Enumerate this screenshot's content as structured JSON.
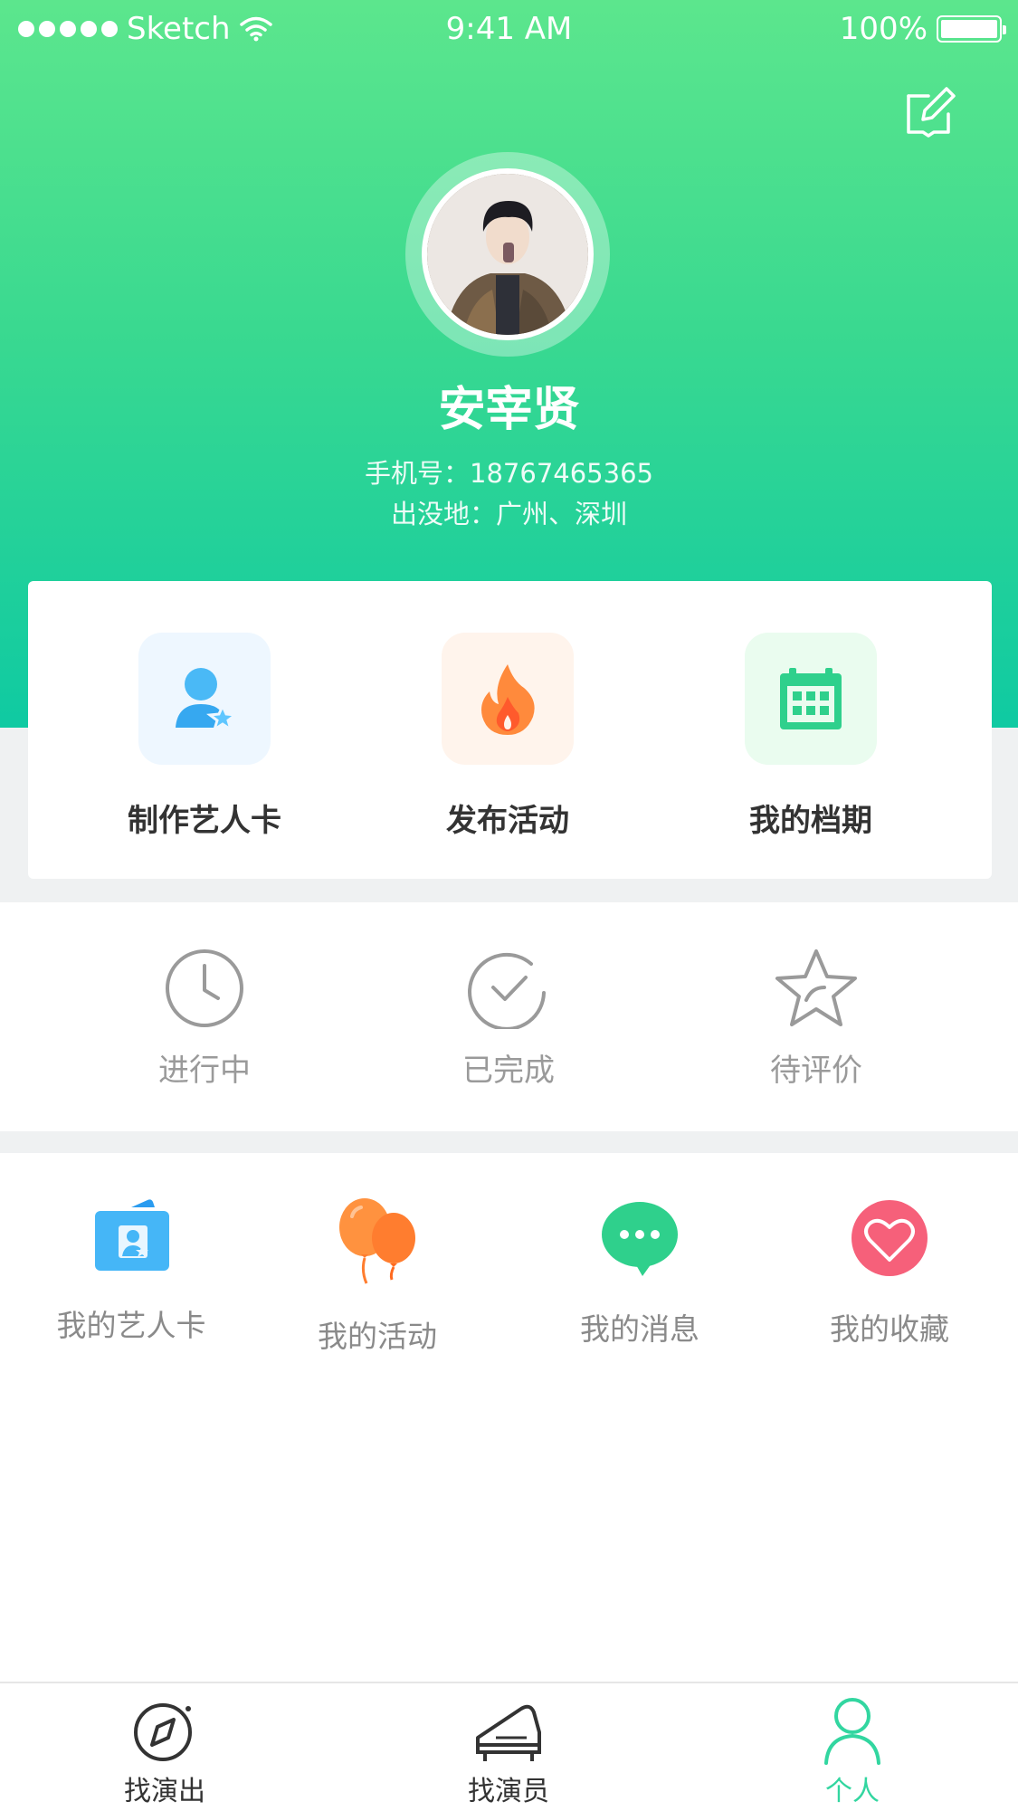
{
  "status_bar": {
    "carrier": "Sketch",
    "time": "9:41 AM",
    "battery": "100%"
  },
  "profile": {
    "name": "安宰贤",
    "phone_line": "手机号：18767465365",
    "location_line": "出没地：广州、深圳"
  },
  "actions": [
    {
      "label": "制作艺人卡",
      "icon": "artist-card-icon",
      "color": "#3fb8f5",
      "bg": "#eef7ff"
    },
    {
      "label": "发布活动",
      "icon": "fire-icon",
      "color": "#ff7a3d",
      "bg": "#fff4ec"
    },
    {
      "label": "我的档期",
      "icon": "calendar-icon",
      "color": "#2fd08c",
      "bg": "#eafcef"
    }
  ],
  "order_status": [
    {
      "label": "进行中",
      "icon": "clock-icon"
    },
    {
      "label": "已完成",
      "icon": "check-circle-icon"
    },
    {
      "label": "待评价",
      "icon": "star-icon"
    }
  ],
  "menu": [
    {
      "label": "我的艺人卡",
      "icon": "id-card-icon"
    },
    {
      "label": "我的活动",
      "icon": "balloon-icon"
    },
    {
      "label": "我的消息",
      "icon": "chat-bubble-icon"
    },
    {
      "label": "我的收藏",
      "icon": "heart-icon"
    }
  ],
  "tabs": [
    {
      "label": "找演出",
      "icon": "compass-icon",
      "active": false
    },
    {
      "label": "找演员",
      "icon": "piano-icon",
      "active": false
    },
    {
      "label": "个人",
      "icon": "person-icon",
      "active": true
    }
  ],
  "colors": {
    "accent": "#32d6a0",
    "header_top": "#5ce68d",
    "header_bottom": "#0fcaa2"
  }
}
